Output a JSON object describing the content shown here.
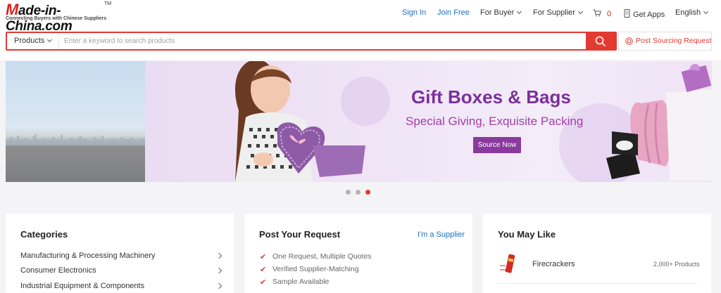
{
  "header": {
    "logo_text": "Made-in-China.com",
    "logo_tm": "TM",
    "logo_tagline": "Connecting Buyers with Chinese Suppliers",
    "nav": {
      "sign_in": "Sign In",
      "join_free": "Join Free",
      "for_buyer": "For Buyer",
      "for_supplier": "For Supplier",
      "cart_count": "0",
      "get_apps": "Get Apps",
      "language": "English"
    }
  },
  "search": {
    "category": "Products",
    "placeholder": "Enter a keyword to search products",
    "post_request": "Post Sourcing Request"
  },
  "banner": {
    "title": "Gift Boxes & Bags",
    "subtitle": "Special Giving, Exquisite Packing",
    "button": "Source Now",
    "slides": 3,
    "active_slide": 3
  },
  "categories": {
    "title": "Categories",
    "items": [
      "Manufacturing & Processing Machinery",
      "Consumer Electronics",
      "Industrial Equipment & Components"
    ]
  },
  "post_request": {
    "title": "Post Your Request",
    "supplier_link": "I'm a Supplier",
    "items": [
      "One Request, Multiple Quotes",
      "Verified Supplier-Matching",
      "Sample Available"
    ]
  },
  "you_may_like": {
    "title": "You May Like",
    "items": [
      {
        "name": "Firecrackers",
        "count": "2,000+ Products"
      }
    ]
  },
  "colors": {
    "brand_red": "#e33a32",
    "link_blue": "#1f6fc5",
    "banner_purple": "#7b2f9a"
  }
}
